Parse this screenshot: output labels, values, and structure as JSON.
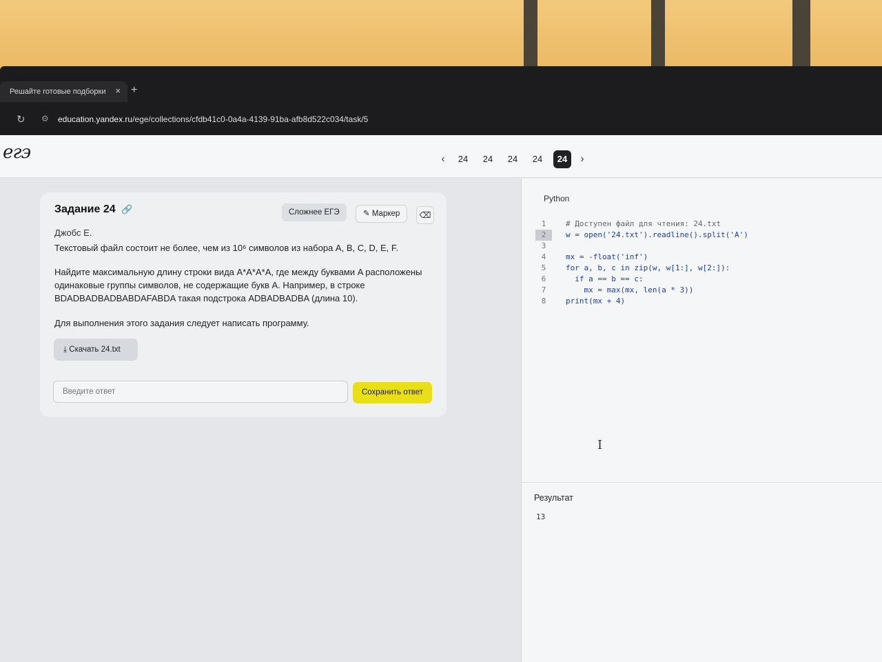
{
  "browser": {
    "tab_title": "Решайте готовые подборки",
    "tab_close": "×",
    "new_tab": "+",
    "reload": "↻",
    "url_host": "education.yandex.ru",
    "url_path": "/ege/collections/cfdb41c0-0a4a-4139-91ba-afb8d522c034/task/5"
  },
  "header": {
    "logo": "егэ",
    "prev": "‹",
    "next": "›",
    "pages": [
      "24",
      "24",
      "24",
      "24",
      "24"
    ],
    "active_page_index": 4
  },
  "task": {
    "title": "Задание 24",
    "link_icon": "🔗",
    "harder_label": "Сложнее ЕГЭ",
    "marker_label": "Маркер",
    "marker_icon": "✎",
    "erase_icon": "⌫",
    "author": "Джобс Е.",
    "p1": "Текстовый файл состоит не более, чем из 10⁶ символов из набора A, B, C, D, E, F.",
    "p2": "Найдите максимальную длину строки вида A*A*A*A, где между буквами A расположены одинаковые группы символов, не содержащие букв A. Например, в строке BDADBADBADBABDAFABDA такая подстрока ADBADBADBA (длина 10).",
    "p3": "Для выполнения этого задания следует написать программу.",
    "download_icon": "⤓",
    "download_label": "Скачать 24.txt",
    "answer_placeholder": "Введите ответ",
    "save_label": "Сохранить ответ"
  },
  "editor": {
    "language": "Python",
    "lines": [
      {
        "n": "1",
        "code": "# Доступен файл для чтения: 24.txt"
      },
      {
        "n": "2",
        "code": "w = open('24.txt').readline().split('A')"
      },
      {
        "n": "3",
        "code": ""
      },
      {
        "n": "4",
        "code": "mx = -float('inf')"
      },
      {
        "n": "5",
        "code": "for a, b, c in zip(w, w[1:], w[2:]):"
      },
      {
        "n": "6",
        "code": "  if a == b == c:"
      },
      {
        "n": "7",
        "code": "    mx = max(mx, len(a * 3))"
      },
      {
        "n": "8",
        "code": "print(mx + 4)"
      }
    ],
    "current_line": "2",
    "result_title": "Результат",
    "result_value": "13"
  }
}
